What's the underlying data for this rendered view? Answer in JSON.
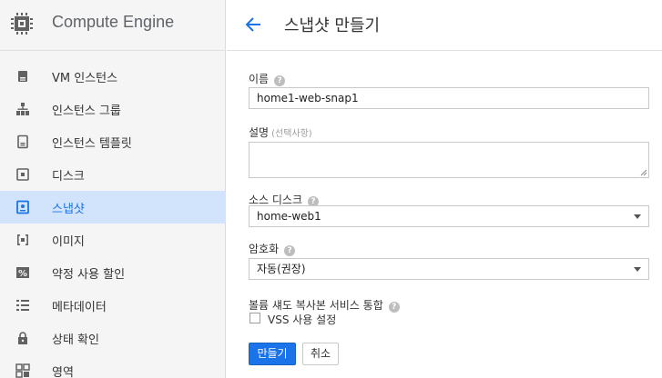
{
  "app": {
    "title": "Compute Engine"
  },
  "sidebar": {
    "items": [
      {
        "label": "VM 인스턴스",
        "icon": "vm-instance-icon",
        "active": false
      },
      {
        "label": "인스턴스 그룹",
        "icon": "instance-group-icon",
        "active": false
      },
      {
        "label": "인스턴스 템플릿",
        "icon": "instance-template-icon",
        "active": false
      },
      {
        "label": "디스크",
        "icon": "disk-icon",
        "active": false
      },
      {
        "label": "스냅샷",
        "icon": "snapshot-icon",
        "active": true
      },
      {
        "label": "이미지",
        "icon": "image-icon",
        "active": false
      },
      {
        "label": "약정 사용 할인",
        "icon": "percent-icon",
        "active": false
      },
      {
        "label": "메타데이터",
        "icon": "metadata-icon",
        "active": false
      },
      {
        "label": "상태 확인",
        "icon": "lock-icon",
        "active": false
      },
      {
        "label": "영역",
        "icon": "zones-icon",
        "active": false
      }
    ]
  },
  "header": {
    "title": "스냅샷 만들기"
  },
  "form": {
    "name": {
      "label": "이름",
      "value": "home1-web-snap1"
    },
    "description": {
      "label": "설명",
      "optional": "(선택사항)",
      "value": ""
    },
    "source_disk": {
      "label": "소스 디스크",
      "value": "home-web1"
    },
    "encryption": {
      "label": "암호화",
      "value": "자동(권장)"
    },
    "vss": {
      "label": "볼륨 섀도 복사본 서비스 통합",
      "checkbox_label": "VSS 사용 설정",
      "checked": false
    },
    "create_label": "만들기",
    "cancel_label": "취소"
  },
  "colors": {
    "accent": "#1a73e8",
    "active_bg": "#d2e3fc",
    "sidebar_bg": "#f5f5f5"
  }
}
